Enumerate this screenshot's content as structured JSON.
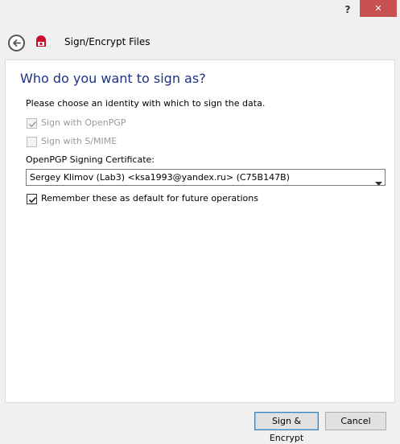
{
  "window": {
    "help_label": "?",
    "close_label": "✕"
  },
  "header": {
    "title": "Sign/Encrypt Files",
    "icons": {
      "back": "back-arrow-icon",
      "app": "kleopatra-app-icon"
    }
  },
  "page": {
    "title": "Who do you want to sign as?",
    "prompt": "Please choose an identity with which to sign the data."
  },
  "options": {
    "sign_openpgp": {
      "label": "Sign with OpenPGP",
      "checked": true,
      "enabled": false
    },
    "sign_smime": {
      "label": "Sign with S/MIME",
      "checked": false,
      "enabled": false
    },
    "remember": {
      "label": "Remember these as default for future operations",
      "checked": true,
      "enabled": true
    }
  },
  "certificate": {
    "label": "OpenPGP Signing Certificate:",
    "selected": "Sergey Klimov (Lab3) <ksa1993@yandex.ru> (C75B147B)"
  },
  "footer": {
    "primary_label": "Sign & Encrypt",
    "cancel_label": "Cancel"
  },
  "colors": {
    "title": "#1e3287",
    "close": "#c75050",
    "app_icon": "#c8102e"
  }
}
